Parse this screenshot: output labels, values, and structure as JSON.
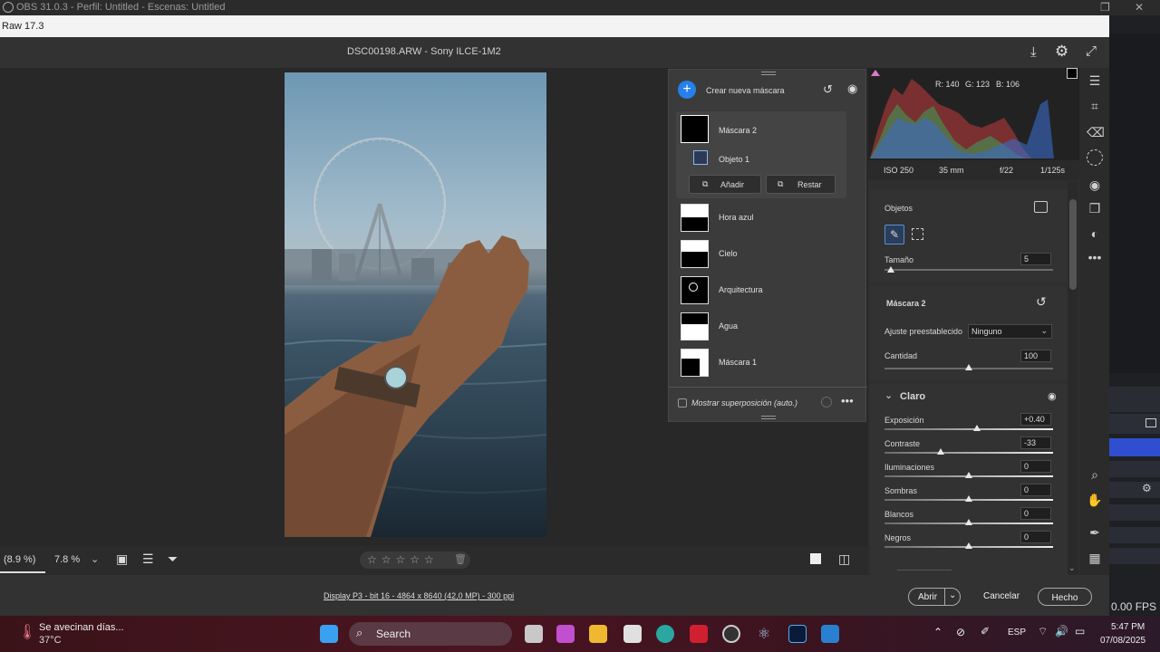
{
  "obs": {
    "title": "OBS 31.0.3 - Perfil: Untitled - Escenas: Untitled",
    "fps": "0.00 FPS"
  },
  "raw": {
    "window_title": "Raw 17.3",
    "file": "DSC00198.ARW -  Sony ILCE-1M2"
  },
  "mask_panel": {
    "create_label": "Crear nueva máscara",
    "masks": [
      {
        "label": "Máscara 2"
      },
      {
        "label": "Objeto 1"
      },
      {
        "label": "Hora azul"
      },
      {
        "label": "Cielo"
      },
      {
        "label": "Arquitectura"
      },
      {
        "label": "Agua"
      },
      {
        "label": "Máscara 1"
      }
    ],
    "add_label": "Añadir",
    "subtract_label": "Restar",
    "overlay_label": "Mostrar superposición (auto.)"
  },
  "histogram": {
    "r": "R: 140",
    "g": "G: 123",
    "b": "B: 106"
  },
  "exif": {
    "iso": "ISO 250",
    "focal": "35 mm",
    "aperture": "f/22",
    "shutter": "1/125s"
  },
  "objects": {
    "title": "Objetos",
    "size_label": "Tamaño",
    "size_value": "5"
  },
  "mask2": {
    "title": "Máscara 2",
    "preset_label": "Ajuste preestablecido",
    "preset_value": "Ninguno",
    "amount_label": "Cantidad",
    "amount_value": "100"
  },
  "claro": {
    "title": "Claro",
    "sliders": [
      {
        "label": "Exposición",
        "value": "+0.40",
        "pos": 0.55
      },
      {
        "label": "Contraste",
        "value": "-33",
        "pos": 0.335
      },
      {
        "label": "Iluminaciones",
        "value": "0",
        "pos": 0.5
      },
      {
        "label": "Sombras",
        "value": "0",
        "pos": 0.5
      },
      {
        "label": "Blancos",
        "value": "0",
        "pos": 0.5
      },
      {
        "label": "Negros",
        "value": "0",
        "pos": 0.5
      }
    ]
  },
  "bottom": {
    "zoom_fit": "(8.9 %)",
    "zoom": "7.8 %"
  },
  "footer": {
    "info": "Display P3 - bit 16 - 4864 x 8640 (42,0 MP) - 300 ppi",
    "open": "Abrir",
    "cancel": "Cancelar",
    "done": "Hecho"
  },
  "taskbar": {
    "weather_text": "Se avecinan días...",
    "temp": "37°C",
    "search": "Search",
    "lang": "ESP",
    "time": "5:47 PM",
    "date": "07/08/2025"
  },
  "colors": {
    "accent": "#2680eb",
    "taskbar": "#4a1420"
  }
}
